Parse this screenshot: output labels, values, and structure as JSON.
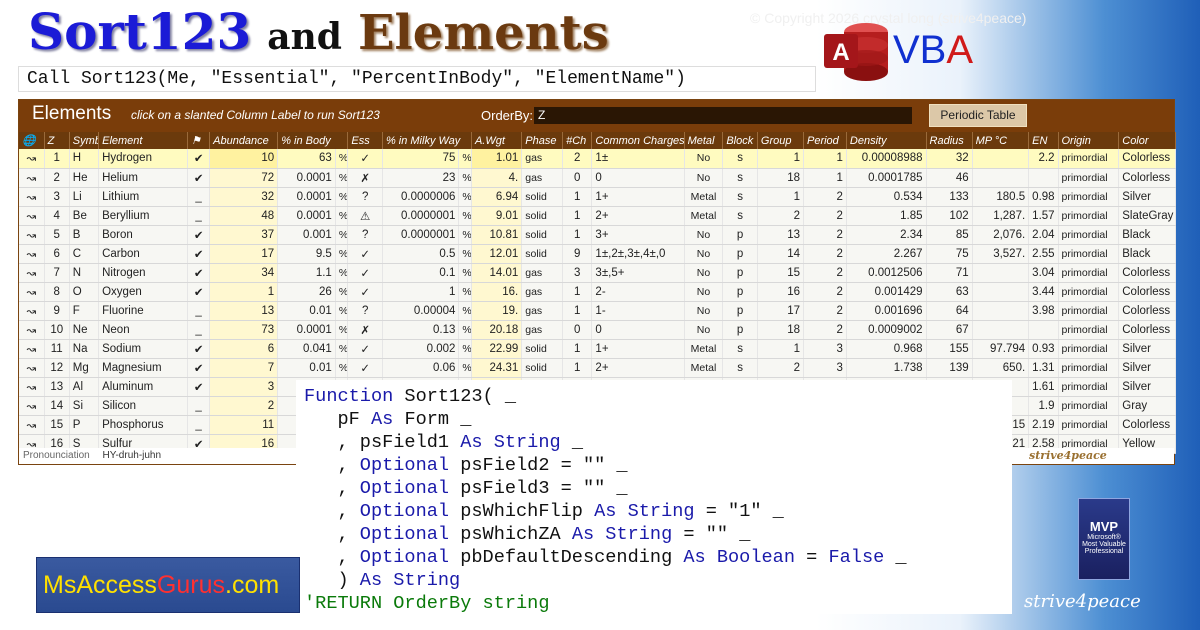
{
  "banner": {
    "title_sort": "Sort123",
    "title_and": "and",
    "title_elements": "Elements",
    "copyright": "© Copyright 2026 crystal long (strive4peace)",
    "call_line": "Call Sort123(Me, \"Essential\", \"PercentInBody\", \"ElementName\")",
    "vba_v": "VB",
    "vba_a": "A",
    "msaccess_gurus_1": "MsAccess",
    "msaccess_gurus_2": "Gurus",
    "msaccess_gurus_3": ".com",
    "mvp_big": "MVP",
    "mvp_small": "Microsoft® Most Valuable Professional",
    "strive": "strive4peace"
  },
  "form": {
    "title": "Elements",
    "hint": "click on a slanted Column Label to run Sort123",
    "orderby_label": "OrderBy:",
    "orderby_value": "Z",
    "periodic_button": "Periodic Table",
    "pronunciation_label": "Pronounciation",
    "pronunciation_value": "HY-druh-juhn",
    "signature": "strive4peace"
  },
  "columns": [
    "Z",
    "Symb",
    "Element",
    "Abundance",
    "% in Body",
    "Ess",
    "% in Milky Way",
    "A.Wgt",
    "Phase",
    "#Ch",
    "Common Charges",
    "Metal",
    "Block",
    "Group",
    "Period",
    "Density",
    "Radius",
    "MP °C",
    "EN",
    "Origin",
    "Color"
  ],
  "rows": [
    {
      "z": "1",
      "sym": "H",
      "name": "Hydrogen",
      "flag": "✔",
      "abund": "10",
      "body": "63",
      "ess": "✓",
      "mw": "75",
      "wgt": "1.01",
      "phase": "gas",
      "ch": "2",
      "charges": "1±",
      "metal": "No",
      "block": "s",
      "group": "1",
      "period": "1",
      "density": "0.00008988",
      "radius": "32",
      "mp": "",
      "en": "2.2",
      "origin": "primordial",
      "color": "Colorless"
    },
    {
      "z": "2",
      "sym": "He",
      "name": "Helium",
      "flag": "✔",
      "abund": "72",
      "body": "0.0001",
      "ess": "✗",
      "mw": "23",
      "wgt": "4.",
      "phase": "gas",
      "ch": "0",
      "charges": "0",
      "metal": "No",
      "block": "s",
      "group": "18",
      "period": "1",
      "density": "0.0001785",
      "radius": "46",
      "mp": "",
      "en": "",
      "origin": "primordial",
      "color": "Colorless"
    },
    {
      "z": "3",
      "sym": "Li",
      "name": "Lithium",
      "flag": "_",
      "abund": "32",
      "body": "0.0001",
      "ess": "?",
      "mw": "0.0000006",
      "wgt": "6.94",
      "phase": "solid",
      "ch": "1",
      "charges": "1+",
      "metal": "Metal",
      "block": "s",
      "group": "1",
      "period": "2",
      "density": "0.534",
      "radius": "133",
      "mp": "180.5",
      "en": "0.98",
      "origin": "primordial",
      "color": "Silver"
    },
    {
      "z": "4",
      "sym": "Be",
      "name": "Beryllium",
      "flag": "_",
      "abund": "48",
      "body": "0.0001",
      "ess": "⚠",
      "mw": "0.0000001",
      "wgt": "9.01",
      "phase": "solid",
      "ch": "1",
      "charges": "2+",
      "metal": "Metal",
      "block": "s",
      "group": "2",
      "period": "2",
      "density": "1.85",
      "radius": "102",
      "mp": "1,287.",
      "en": "1.57",
      "origin": "primordial",
      "color": "SlateGray"
    },
    {
      "z": "5",
      "sym": "B",
      "name": "Boron",
      "flag": "✔",
      "abund": "37",
      "body": "0.001",
      "ess": "?",
      "mw": "0.0000001",
      "wgt": "10.81",
      "phase": "solid",
      "ch": "1",
      "charges": "3+",
      "metal": "No",
      "block": "p",
      "group": "13",
      "period": "2",
      "density": "2.34",
      "radius": "85",
      "mp": "2,076.",
      "en": "2.04",
      "origin": "primordial",
      "color": "Black"
    },
    {
      "z": "6",
      "sym": "C",
      "name": "Carbon",
      "flag": "✔",
      "abund": "17",
      "body": "9.5",
      "ess": "✓",
      "mw": "0.5",
      "wgt": "12.01",
      "phase": "solid",
      "ch": "9",
      "charges": "1±,2±,3±,4±,0",
      "metal": "No",
      "block": "p",
      "group": "14",
      "period": "2",
      "density": "2.267",
      "radius": "75",
      "mp": "3,527.",
      "en": "2.55",
      "origin": "primordial",
      "color": "Black"
    },
    {
      "z": "7",
      "sym": "N",
      "name": "Nitrogen",
      "flag": "✔",
      "abund": "34",
      "body": "1.1",
      "ess": "✓",
      "mw": "0.1",
      "wgt": "14.01",
      "phase": "gas",
      "ch": "3",
      "charges": "3±,5+",
      "metal": "No",
      "block": "p",
      "group": "15",
      "period": "2",
      "density": "0.0012506",
      "radius": "71",
      "mp": "",
      "en": "3.04",
      "origin": "primordial",
      "color": "Colorless"
    },
    {
      "z": "8",
      "sym": "O",
      "name": "Oxygen",
      "flag": "✔",
      "abund": "1",
      "body": "26",
      "ess": "✓",
      "mw": "1",
      "wgt": "16.",
      "phase": "gas",
      "ch": "1",
      "charges": "2-",
      "metal": "No",
      "block": "p",
      "group": "16",
      "period": "2",
      "density": "0.001429",
      "radius": "63",
      "mp": "",
      "en": "3.44",
      "origin": "primordial",
      "color": "Colorless"
    },
    {
      "z": "9",
      "sym": "F",
      "name": "Fluorine",
      "flag": "_",
      "abund": "13",
      "body": "0.01",
      "ess": "?",
      "mw": "0.00004",
      "wgt": "19.",
      "phase": "gas",
      "ch": "1",
      "charges": "1-",
      "metal": "No",
      "block": "p",
      "group": "17",
      "period": "2",
      "density": "0.001696",
      "radius": "64",
      "mp": "",
      "en": "3.98",
      "origin": "primordial",
      "color": "Colorless"
    },
    {
      "z": "10",
      "sym": "Ne",
      "name": "Neon",
      "flag": "_",
      "abund": "73",
      "body": "0.0001",
      "ess": "✗",
      "mw": "0.13",
      "wgt": "20.18",
      "phase": "gas",
      "ch": "0",
      "charges": "0",
      "metal": "No",
      "block": "p",
      "group": "18",
      "period": "2",
      "density": "0.0009002",
      "radius": "67",
      "mp": "",
      "en": "",
      "origin": "primordial",
      "color": "Colorless"
    },
    {
      "z": "11",
      "sym": "Na",
      "name": "Sodium",
      "flag": "✔",
      "abund": "6",
      "body": "0.041",
      "ess": "✓",
      "mw": "0.002",
      "wgt": "22.99",
      "phase": "solid",
      "ch": "1",
      "charges": "1+",
      "metal": "Metal",
      "block": "s",
      "group": "1",
      "period": "3",
      "density": "0.968",
      "radius": "155",
      "mp": "97.794",
      "en": "0.93",
      "origin": "primordial",
      "color": "Silver"
    },
    {
      "z": "12",
      "sym": "Mg",
      "name": "Magnesium",
      "flag": "✔",
      "abund": "7",
      "body": "0.01",
      "ess": "✓",
      "mw": "0.06",
      "wgt": "24.31",
      "phase": "solid",
      "ch": "1",
      "charges": "2+",
      "metal": "Metal",
      "block": "s",
      "group": "2",
      "period": "3",
      "density": "1.738",
      "radius": "139",
      "mp": "650.",
      "en": "1.31",
      "origin": "primordial",
      "color": "Silver"
    },
    {
      "z": "13",
      "sym": "Al",
      "name": "Aluminum",
      "flag": "✔",
      "abund": "3",
      "body": "",
      "ess": "",
      "mw": "",
      "wgt": "",
      "phase": "",
      "ch": "",
      "charges": "",
      "metal": "",
      "block": "",
      "group": "",
      "period": "",
      "density": "",
      "radius": "",
      "mp": "",
      "en": "1.61",
      "origin": "primordial",
      "color": "Silver"
    },
    {
      "z": "14",
      "sym": "Si",
      "name": "Silicon",
      "flag": "_",
      "abund": "2",
      "body": "",
      "ess": "",
      "mw": "",
      "wgt": "",
      "phase": "",
      "ch": "",
      "charges": "",
      "metal": "",
      "block": "",
      "group": "",
      "period": "",
      "density": "",
      "radius": "",
      "mp": "",
      "en": "1.9",
      "origin": "primordial",
      "color": "Gray"
    },
    {
      "z": "15",
      "sym": "P",
      "name": "Phosphorus",
      "flag": "_",
      "abund": "11",
      "body": "",
      "ess": "",
      "mw": "",
      "wgt": "",
      "phase": "",
      "ch": "",
      "charges": "",
      "metal": "",
      "block": "",
      "group": "",
      "period": "",
      "density": "",
      "radius": "",
      "mp": "15",
      "en": "2.19",
      "origin": "primordial",
      "color": "Colorless"
    },
    {
      "z": "16",
      "sym": "S",
      "name": "Sulfur",
      "flag": "✔",
      "abund": "16",
      "body": "",
      "ess": "",
      "mw": "",
      "wgt": "",
      "phase": "",
      "ch": "",
      "charges": "",
      "metal": "",
      "block": "",
      "group": "",
      "period": "",
      "density": "",
      "radius": "",
      "mp": "21",
      "en": "2.58",
      "origin": "primordial",
      "color": "Yellow"
    }
  ],
  "code": {
    "l1_kw": "Function",
    "l1_rest": " Sort123( _",
    "l2_a": "   pF ",
    "l2_kw": "As",
    "l2_b": " Form _",
    "l3_a": "   , psField1 ",
    "l3_kw": "As String",
    "l3_b": " _",
    "l4_a": "   , ",
    "l4_kw": "Optional",
    "l4_b": " psField2 = \"\" _",
    "l5_a": "   , ",
    "l5_kw": "Optional",
    "l5_b": " psField3 = \"\" _",
    "l6_a": "   , ",
    "l6_kw": "Optional",
    "l6_b": " psWhichFlip ",
    "l6_kw2": "As String",
    "l6_c": " = \"1\" _",
    "l7_a": "   , ",
    "l7_kw": "Optional",
    "l7_b": " psWhichZA ",
    "l7_kw2": "As String",
    "l7_c": " = \"\" _",
    "l8_a": "   , ",
    "l8_kw": "Optional",
    "l8_b": " pbDefaultDescending ",
    "l8_kw2": "As Boolean",
    "l8_c": " = ",
    "l8_kw3": "False",
    "l8_d": " _",
    "l9_a": "   ) ",
    "l9_kw": "As String",
    "l10": "'RETURN OrderBy string"
  }
}
